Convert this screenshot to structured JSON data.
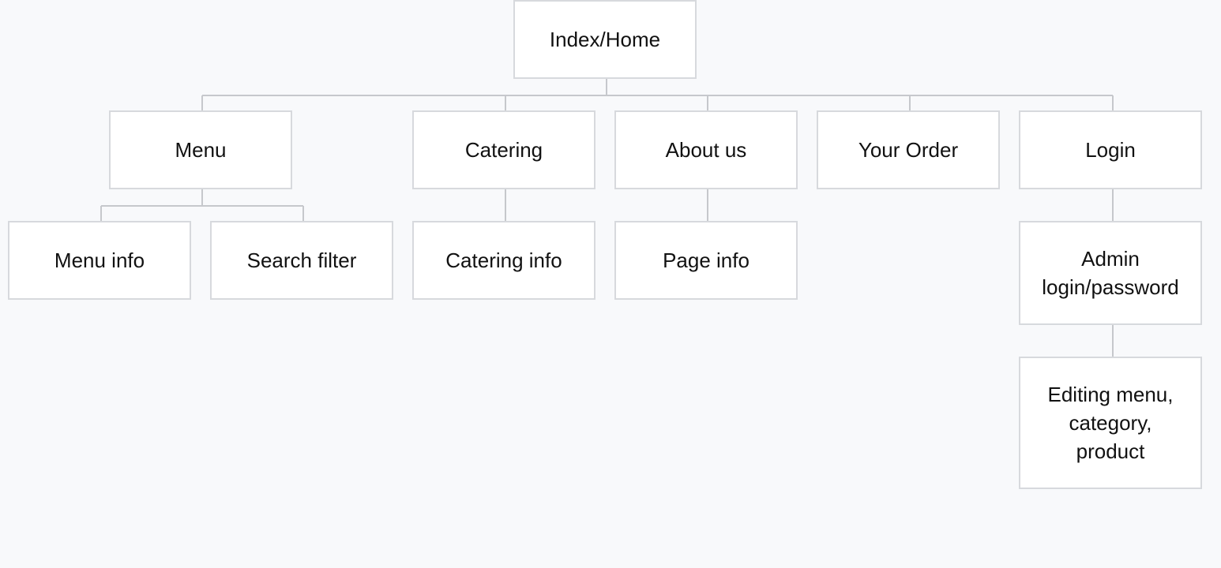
{
  "sitemap": {
    "root": {
      "label": "Index/Home"
    },
    "sections": {
      "menu": {
        "label": "Menu",
        "children": [
          {
            "label": "Menu info"
          },
          {
            "label": "Search filter"
          }
        ]
      },
      "catering": {
        "label": "Catering",
        "children": [
          {
            "label": "Catering info"
          }
        ]
      },
      "about_us": {
        "label": "About us",
        "children": [
          {
            "label": "Page info"
          }
        ]
      },
      "your_order": {
        "label": "Your Order"
      },
      "login": {
        "label": "Login",
        "children": [
          {
            "label": "Admin login/password",
            "children": [
              {
                "label": "Editing menu, category, product"
              }
            ]
          }
        ]
      }
    }
  }
}
